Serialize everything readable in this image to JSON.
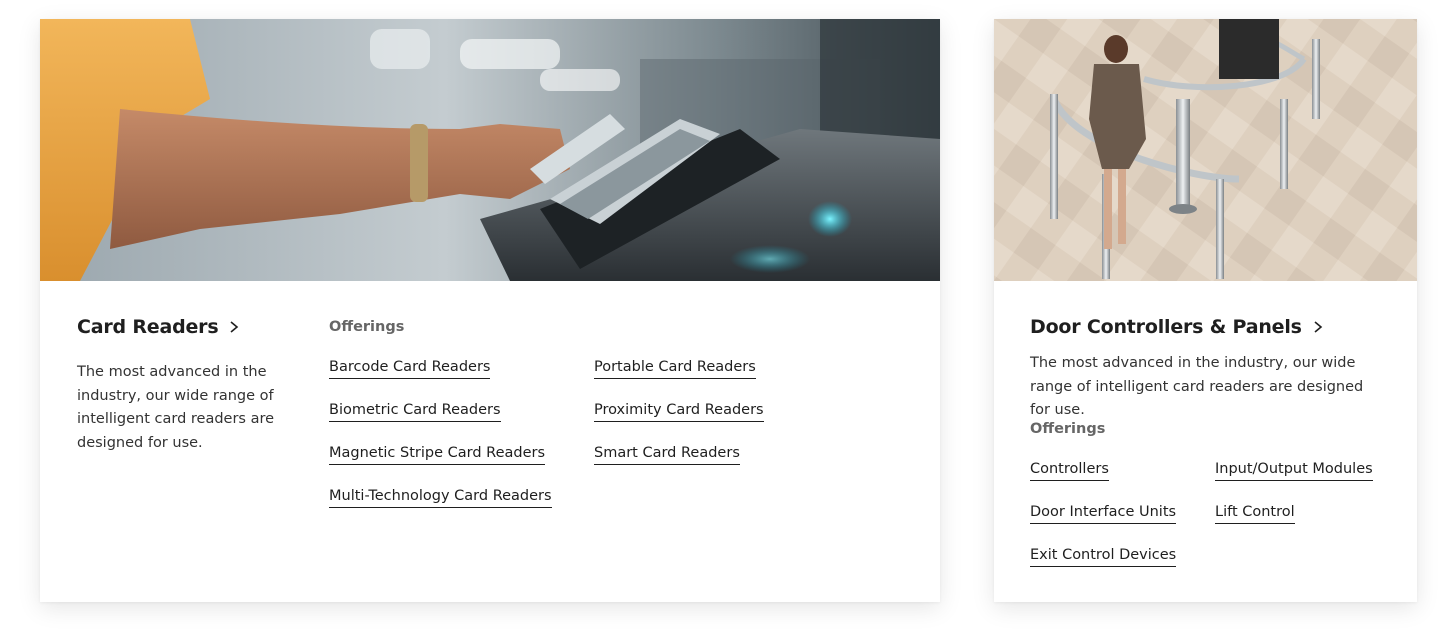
{
  "cards": [
    {
      "title": "Card Readers",
      "description": "The most advanced in the industry, our wide range of intelligent card readers are designed for use.",
      "offerings_label": "Offerings",
      "offerings": [
        "Barcode Card Readers",
        "Biometric Card Readers",
        "Magnetic Stripe Card Readers",
        "Multi-Technology Card Readers",
        "Portable Card Readers",
        "Proximity Card Readers",
        "Smart Card Readers"
      ]
    },
    {
      "title": "Door Controllers & Panels",
      "description": "The most advanced in the industry, our wide range of intelligent card readers are designed for use.",
      "offerings_label": "Offerings",
      "offerings": [
        "Controllers",
        "Door Interface Units",
        "Exit Control Devices",
        "Input/Output Modules",
        "Lift Control"
      ]
    }
  ],
  "colors": {
    "text": "#1f1f1f",
    "muted": "#666666",
    "card_bg": "#ffffff"
  },
  "icons": {
    "title_chevron": "chevron-right-icon"
  }
}
